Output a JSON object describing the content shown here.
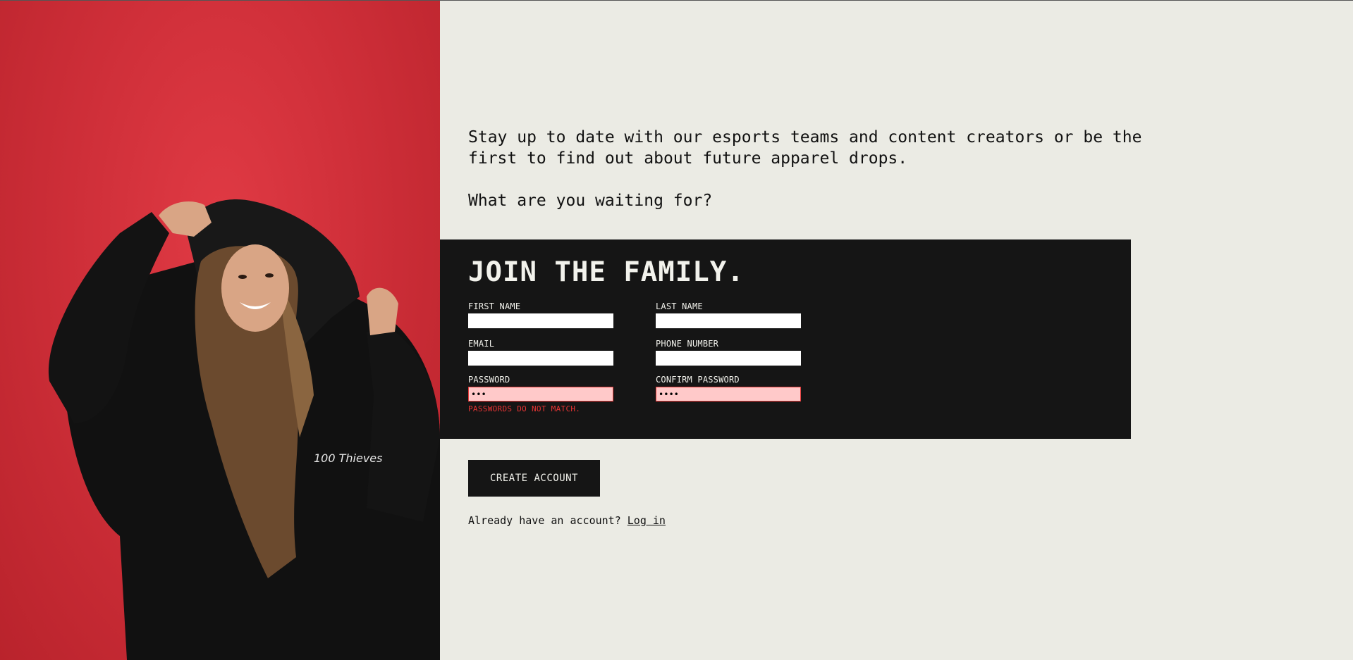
{
  "intro": {
    "paragraph": "Stay up to date with our esports teams and content creators or be the\nfirst to find out about future apparel drops.",
    "question": "What are you waiting for?"
  },
  "form": {
    "title": "JOIN THE FAMILY.",
    "first_name": {
      "label": "FIRST NAME",
      "value": ""
    },
    "last_name": {
      "label": "LAST NAME",
      "value": ""
    },
    "email": {
      "label": "EMAIL",
      "value": ""
    },
    "phone": {
      "label": "PHONE NUMBER",
      "value": ""
    },
    "password": {
      "label": "PASSWORD",
      "value": "•••"
    },
    "confirm_password": {
      "label": "CONFIRM PASSWORD",
      "value": "••••"
    },
    "error_message": "PASSWORDS DO NOT MATCH."
  },
  "actions": {
    "create_label": "CREATE ACCOUNT",
    "login_prompt": "Already have an account?",
    "login_link": "Log in"
  },
  "hero": {
    "image_subject": "model in black 100 Thieves hoodie on red background",
    "hoodie_logo": "100 Thieves"
  },
  "colors": {
    "accent_red": "#d1303a",
    "panel_dark": "#151515",
    "page_bg": "#ebebe4",
    "error_fill": "#ffc9c9",
    "error_text": "#e83434"
  }
}
